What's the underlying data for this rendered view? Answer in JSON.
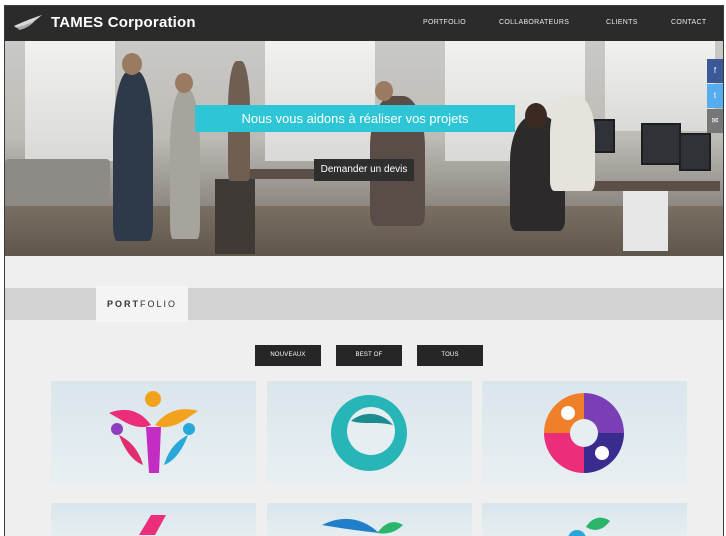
{
  "header": {
    "brand": "TAMES Corporation",
    "nav": [
      "PORTFOLIO",
      "COLLABORATEURS",
      "CLIENTS",
      "CONTACT"
    ]
  },
  "hero": {
    "headline": "Nous vous aidons à réaliser vos projets",
    "cta_label": "Demander un devis"
  },
  "social": [
    {
      "icon": "facebook-icon",
      "glyph": "f"
    },
    {
      "icon": "twitter-icon",
      "glyph": "t"
    },
    {
      "icon": "email-icon",
      "glyph": "✉"
    }
  ],
  "portfolio": {
    "title_bold": "PORT",
    "title_rest": "FOLIO",
    "filters": [
      "NOUVEAUX",
      "BEST OF",
      "TOUS"
    ]
  },
  "colors": {
    "header_bg": "#2b2b2b",
    "accent_cyan": "#2ec5d6",
    "button_dark": "#262626",
    "social_blue": "#5b7cc0"
  }
}
